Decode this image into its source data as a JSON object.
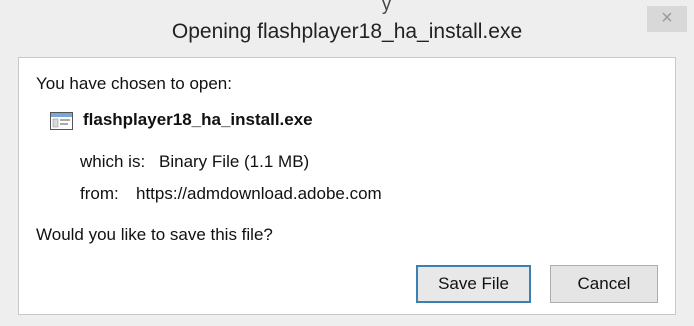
{
  "window": {
    "title": "Opening flashplayer18_ha_install.exe",
    "title_fragment": "y"
  },
  "titlebar": {
    "close_glyph": "×"
  },
  "dialog": {
    "intro": "You have chosen to open:",
    "file_name": "flashplayer18_ha_install.exe",
    "file_icon": "executable-file-icon",
    "which_is_label": "which is:",
    "which_is_value": "Binary File (1.1 MB)",
    "from_label": "from:",
    "from_value": "https://admdownload.adobe.com",
    "question": "Would you like to save this file?"
  },
  "buttons": {
    "save_label": "Save File",
    "cancel_label": "Cancel"
  },
  "colors": {
    "window_bg": "#eeeeee",
    "content_bg": "#ffffff",
    "button_focus_border": "#3c7fb1",
    "close_button_bg": "#d8d8d8"
  }
}
